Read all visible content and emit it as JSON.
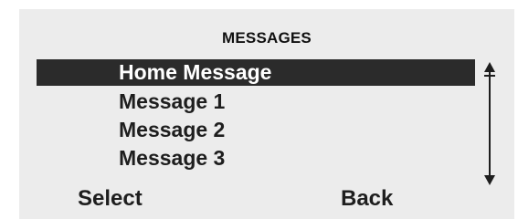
{
  "screen": {
    "title": "MESSAGES"
  },
  "menu": {
    "items": [
      {
        "label": "Home Message",
        "selected": true
      },
      {
        "label": "Message 1",
        "selected": false
      },
      {
        "label": "Message 2",
        "selected": false
      },
      {
        "label": "Message 3",
        "selected": false
      }
    ]
  },
  "scrollbar": {
    "icon": "scroll-up-down-arrow-icon"
  },
  "softkeys": {
    "left_label": "Select",
    "right_label": "Back"
  }
}
